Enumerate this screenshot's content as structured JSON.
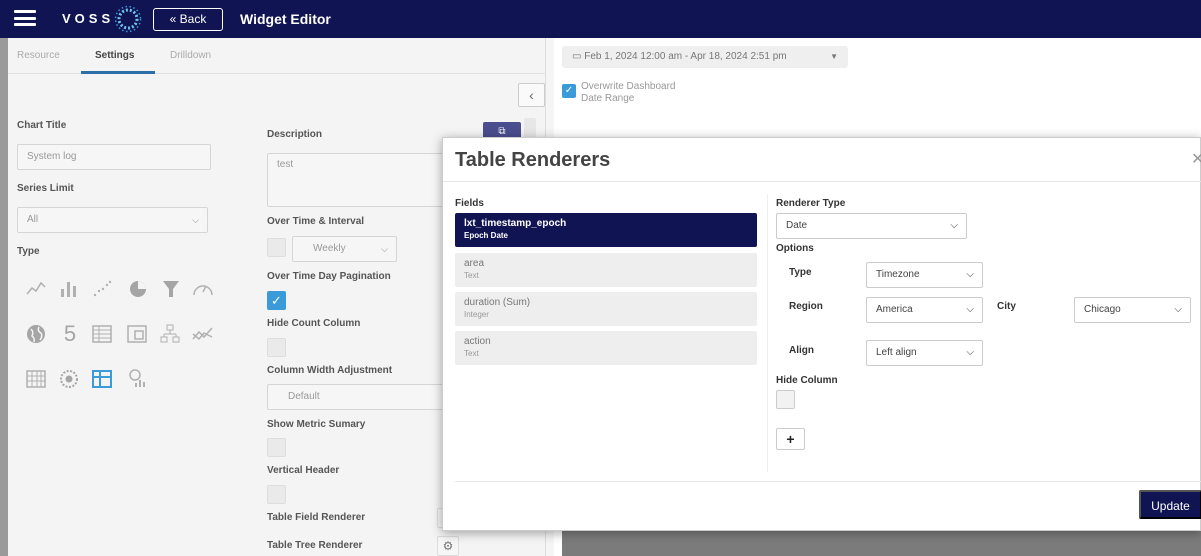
{
  "topbar": {
    "logo_text": "VOSS",
    "back_label": "« Back",
    "title": "Widget Editor"
  },
  "tabs": [
    {
      "label": "Resource",
      "active": false
    },
    {
      "label": "Settings",
      "active": true
    },
    {
      "label": "Drilldown",
      "active": false
    }
  ],
  "settings": {
    "chart_title_label": "Chart Title",
    "chart_title_value": "System log",
    "series_limit_label": "Series Limit",
    "series_limit_value": "All",
    "type_label": "Type",
    "description_label": "Description",
    "description_value": "test",
    "over_time_label": "Over Time & Interval",
    "interval_value": "Weekly",
    "day_pagination_label": "Over Time Day Pagination",
    "hide_count_label": "Hide Count Column",
    "col_width_label": "Column Width Adjustment",
    "col_width_value": "Default",
    "metric_summary_label": "Show Metric Sumary",
    "vertical_header_label": "Vertical Header",
    "field_renderer_label": "Table Field Renderer",
    "tree_renderer_label": "Table Tree Renderer",
    "type_icons": [
      "line-chart-icon",
      "bar-chart-icon",
      "scatter-chart-icon",
      "pie-chart-icon",
      "funnel-chart-icon",
      "gauge-chart-icon",
      "globe-map-icon",
      "number-icon",
      "table-icon",
      "grid-table-icon",
      "tree-icon",
      "trend-icon",
      "heatmap-icon",
      "snowflake-icon",
      "pivot-table-icon",
      "bubble-chart-icon"
    ],
    "selected_type": "pivot-table-icon",
    "number_icon_glyph": "5"
  },
  "date_range": {
    "value": "Feb 1, 2024 12:00 am - Apr 18, 2024 2:51 pm",
    "overwrite_label": "Overwrite Dashboard Date Range",
    "overwrite_checked": true
  },
  "modal": {
    "title": "Table Renderers",
    "fields_label": "Fields",
    "fields": [
      {
        "name": "lxt_timestamp_epoch",
        "type": "Epoch Date",
        "selected": true
      },
      {
        "name": "area",
        "type": "Text",
        "selected": false
      },
      {
        "name": "duration (Sum)",
        "type": "Integer",
        "selected": false
      },
      {
        "name": "action",
        "type": "Text",
        "selected": false
      }
    ],
    "renderer_type_label": "Renderer Type",
    "renderer_type_value": "Date",
    "options_label": "Options",
    "type_label": "Type",
    "type_value": "Timezone",
    "region_label": "Region",
    "region_value": "America",
    "city_label": "City",
    "city_value": "Chicago",
    "align_label": "Align",
    "align_value": "Left align",
    "hide_column_label": "Hide Column",
    "add_label": "+",
    "update_label": "Update"
  },
  "colors": {
    "nav": "#111452",
    "accent": "#3b9bd9",
    "tab_underline": "#2d6fa7"
  }
}
